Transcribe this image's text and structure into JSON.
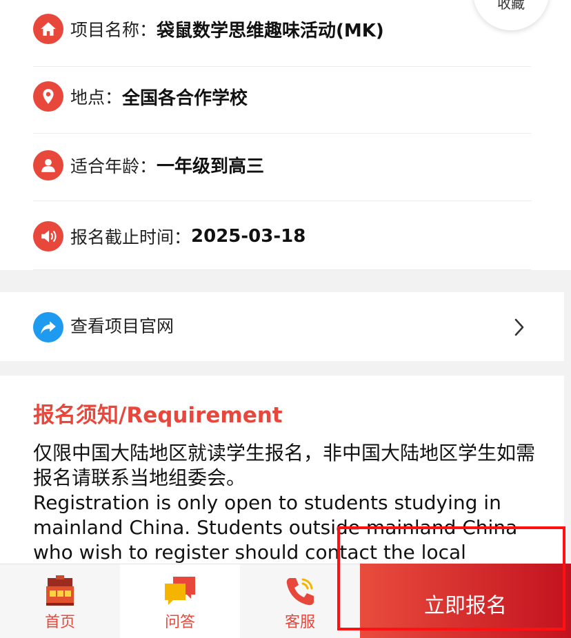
{
  "favorite": {
    "label": "收藏"
  },
  "info": {
    "items": [
      {
        "icon": "home-icon",
        "label": "项目名称：",
        "value": "袋鼠数学思维趣味活动(MK)"
      },
      {
        "icon": "location-pin-icon",
        "label": "地点：",
        "value": "全国各合作学校"
      },
      {
        "icon": "user-icon",
        "label": "适合年龄：",
        "value": "一年级到高三"
      },
      {
        "icon": "speaker-icon",
        "label": "报名截止时间：",
        "value": "2025-03-18"
      }
    ]
  },
  "website": {
    "icon": "share-arrow-icon",
    "label": "查看项目官网"
  },
  "notice": {
    "title": "报名须知/Requirement",
    "line_cn": "仅限中国大陆地区就读学生报名，非中国大陆地区学生如需报名请联系当地组委会。",
    "line_en": "Registration is only open to students studying in mainland China. Students outside mainland China who wish to register should contact the local"
  },
  "nav": {
    "items": [
      {
        "icon": "house-icon",
        "label": "首页"
      },
      {
        "icon": "chat-bubbles-icon",
        "label": "问答"
      },
      {
        "icon": "phone-icon",
        "label": "客服"
      }
    ]
  },
  "signup": {
    "label": "立即报名"
  },
  "colors": {
    "accent": "#e8483c",
    "link_blue": "#1e9bf0",
    "signup_gradient_end": "#c2121f",
    "highlight": "#ff1111"
  }
}
